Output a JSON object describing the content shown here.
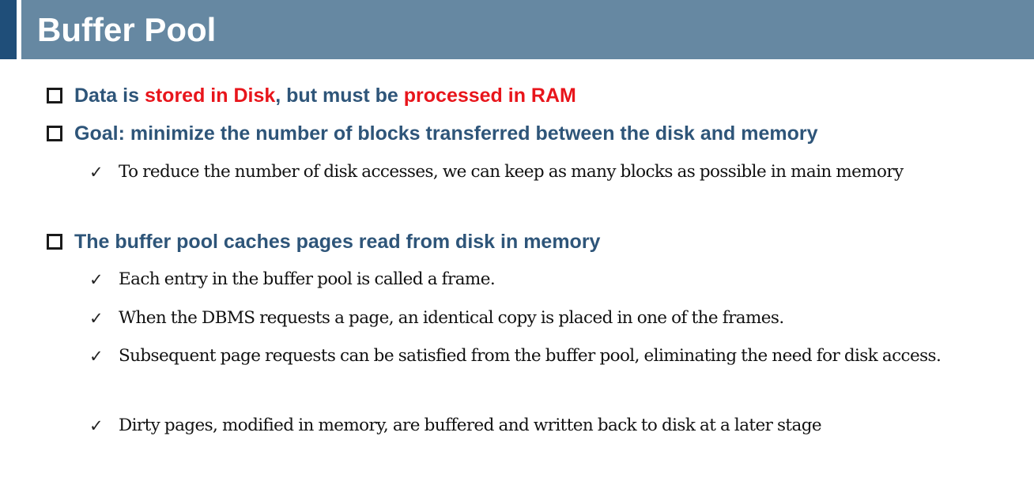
{
  "slide": {
    "title": "Buffer Pool",
    "bullets": [
      {
        "parts": [
          {
            "text": "Data is ",
            "highlight": false
          },
          {
            "text": "stored in Disk",
            "highlight": true
          },
          {
            "text": ", but must be ",
            "highlight": false
          },
          {
            "text": "processed in RAM",
            "highlight": true
          }
        ],
        "subbullets": []
      },
      {
        "text": "Goal: minimize the number of blocks transferred between the disk and memory",
        "subbullets": [
          "To reduce the number of disk accesses, we can keep as many blocks as possible in main memory"
        ]
      },
      {
        "text": "The buffer pool caches pages read from disk in memory",
        "subbullets": [
          "Each entry in the buffer pool is called a frame.",
          "When the DBMS requests a page, an identical copy is placed in one of the frames.",
          "Subsequent page requests can be satisfied from the buffer pool, eliminating the need for disk access.",
          "Dirty pages, modified in memory, are buffered and written back to disk at a later stage"
        ]
      }
    ]
  },
  "colors": {
    "title_bar": "#6688a2",
    "title_accent": "#1f4e79",
    "heading_text": "#2e5579",
    "highlight_text": "#e8151b"
  },
  "icons": {
    "level1": "square-bullet-icon",
    "level2": "checkmark-icon"
  }
}
